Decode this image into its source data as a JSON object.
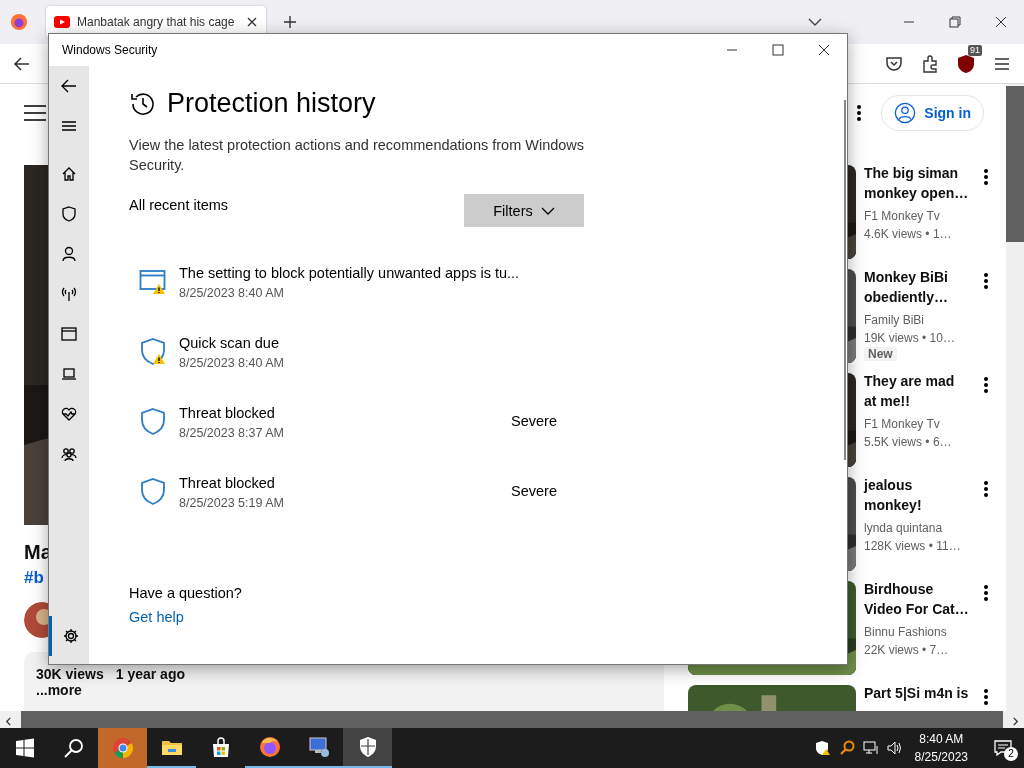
{
  "browser": {
    "tab": {
      "title": "Manbatak angry that his cage"
    },
    "toolbar": {
      "blocked_count": "91"
    },
    "page": {
      "sign_in": "Sign in",
      "video": {
        "kind": "picture",
        "title": "Ma",
        "hashtag": "#b",
        "views": "30K views",
        "age": "1 year ago",
        "more": "...more"
      },
      "related": [
        {
          "title": [
            "The big siman",
            "monkey open…"
          ],
          "channel": "F1 Monkey Tv",
          "stats": "4.6K views  • 1…"
        },
        {
          "title": [
            "Monkey BiBi",
            "obediently…"
          ],
          "channel": "Family BiBi",
          "stats": "19K views  • 10…",
          "badge": "New"
        },
        {
          "title": [
            "They are mad",
            "at me!!"
          ],
          "channel": "F1 Monkey Tv",
          "stats": "5.5K views  • 6…"
        },
        {
          "title": [
            "jealous",
            "monkey!"
          ],
          "channel": "lynda quintana",
          "stats": "128K views  • 11…"
        },
        {
          "title": [
            "Birdhouse",
            "Video For Cat…"
          ],
          "channel": "Binnu Fashions",
          "stats": "22K views  • 7…"
        },
        {
          "title": [
            "Part 5|Si m4n is"
          ]
        }
      ]
    }
  },
  "security_window": {
    "title": "Windows Security",
    "nav": [
      {
        "kind": "home",
        "selected": false
      },
      {
        "kind": "shield",
        "selected": false
      },
      {
        "kind": "account",
        "selected": false
      },
      {
        "kind": "network",
        "selected": false
      },
      {
        "kind": "app_browser",
        "selected": false
      },
      {
        "kind": "device",
        "selected": false
      },
      {
        "kind": "health",
        "selected": false
      },
      {
        "kind": "family",
        "selected": false
      },
      {
        "kind": "settings",
        "selected": true
      }
    ],
    "heading": "Protection history",
    "description": "View the latest protection actions and recommendations from Windows Security.",
    "list_label": "All recent items",
    "filters_button": "Filters",
    "items": [
      {
        "kind": "app_warning",
        "title": "The setting to block potentially unwanted apps is tu...",
        "date": "8/25/2023 8:40 AM"
      },
      {
        "kind": "shield_warning",
        "title": "Quick scan due",
        "date": "8/25/2023 8:40 AM"
      },
      {
        "kind": "shield",
        "title": "Threat blocked",
        "date": "8/25/2023 8:37 AM",
        "severity": "Severe"
      },
      {
        "kind": "shield",
        "title": "Threat blocked",
        "date": "8/25/2023 5:19 AM",
        "severity": "Severe"
      }
    ],
    "question": "Have a question?",
    "help_link": "Get help"
  },
  "taskbar": {
    "apps": [
      {
        "kind": "chrome",
        "flashing": true,
        "running": false,
        "selected": false
      },
      {
        "kind": "explorer",
        "flashing": false,
        "running": true,
        "selected": false
      },
      {
        "kind": "store",
        "flashing": false,
        "running": false,
        "selected": false
      },
      {
        "kind": "firefox",
        "flashing": false,
        "running": true,
        "selected": false
      },
      {
        "kind": "remote",
        "flashing": false,
        "running": true,
        "selected": false
      },
      {
        "kind": "security",
        "flashing": false,
        "running": true,
        "selected": true
      }
    ],
    "time": "8:40 AM",
    "date": "8/25/2023",
    "notifications": "2"
  }
}
